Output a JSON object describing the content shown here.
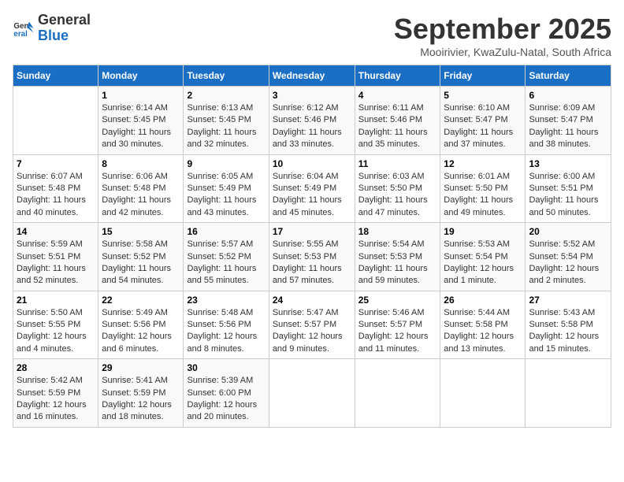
{
  "logo": {
    "line1": "General",
    "line2": "Blue"
  },
  "title": "September 2025",
  "subtitle": "Mooirivier, KwaZulu-Natal, South Africa",
  "days_of_week": [
    "Sunday",
    "Monday",
    "Tuesday",
    "Wednesday",
    "Thursday",
    "Friday",
    "Saturday"
  ],
  "weeks": [
    [
      {
        "day": "",
        "info": ""
      },
      {
        "day": "1",
        "info": "Sunrise: 6:14 AM\nSunset: 5:45 PM\nDaylight: 11 hours\nand 30 minutes."
      },
      {
        "day": "2",
        "info": "Sunrise: 6:13 AM\nSunset: 5:45 PM\nDaylight: 11 hours\nand 32 minutes."
      },
      {
        "day": "3",
        "info": "Sunrise: 6:12 AM\nSunset: 5:46 PM\nDaylight: 11 hours\nand 33 minutes."
      },
      {
        "day": "4",
        "info": "Sunrise: 6:11 AM\nSunset: 5:46 PM\nDaylight: 11 hours\nand 35 minutes."
      },
      {
        "day": "5",
        "info": "Sunrise: 6:10 AM\nSunset: 5:47 PM\nDaylight: 11 hours\nand 37 minutes."
      },
      {
        "day": "6",
        "info": "Sunrise: 6:09 AM\nSunset: 5:47 PM\nDaylight: 11 hours\nand 38 minutes."
      }
    ],
    [
      {
        "day": "7",
        "info": "Sunrise: 6:07 AM\nSunset: 5:48 PM\nDaylight: 11 hours\nand 40 minutes."
      },
      {
        "day": "8",
        "info": "Sunrise: 6:06 AM\nSunset: 5:48 PM\nDaylight: 11 hours\nand 42 minutes."
      },
      {
        "day": "9",
        "info": "Sunrise: 6:05 AM\nSunset: 5:49 PM\nDaylight: 11 hours\nand 43 minutes."
      },
      {
        "day": "10",
        "info": "Sunrise: 6:04 AM\nSunset: 5:49 PM\nDaylight: 11 hours\nand 45 minutes."
      },
      {
        "day": "11",
        "info": "Sunrise: 6:03 AM\nSunset: 5:50 PM\nDaylight: 11 hours\nand 47 minutes."
      },
      {
        "day": "12",
        "info": "Sunrise: 6:01 AM\nSunset: 5:50 PM\nDaylight: 11 hours\nand 49 minutes."
      },
      {
        "day": "13",
        "info": "Sunrise: 6:00 AM\nSunset: 5:51 PM\nDaylight: 11 hours\nand 50 minutes."
      }
    ],
    [
      {
        "day": "14",
        "info": "Sunrise: 5:59 AM\nSunset: 5:51 PM\nDaylight: 11 hours\nand 52 minutes."
      },
      {
        "day": "15",
        "info": "Sunrise: 5:58 AM\nSunset: 5:52 PM\nDaylight: 11 hours\nand 54 minutes."
      },
      {
        "day": "16",
        "info": "Sunrise: 5:57 AM\nSunset: 5:52 PM\nDaylight: 11 hours\nand 55 minutes."
      },
      {
        "day": "17",
        "info": "Sunrise: 5:55 AM\nSunset: 5:53 PM\nDaylight: 11 hours\nand 57 minutes."
      },
      {
        "day": "18",
        "info": "Sunrise: 5:54 AM\nSunset: 5:53 PM\nDaylight: 11 hours\nand 59 minutes."
      },
      {
        "day": "19",
        "info": "Sunrise: 5:53 AM\nSunset: 5:54 PM\nDaylight: 12 hours\nand 1 minute."
      },
      {
        "day": "20",
        "info": "Sunrise: 5:52 AM\nSunset: 5:54 PM\nDaylight: 12 hours\nand 2 minutes."
      }
    ],
    [
      {
        "day": "21",
        "info": "Sunrise: 5:50 AM\nSunset: 5:55 PM\nDaylight: 12 hours\nand 4 minutes."
      },
      {
        "day": "22",
        "info": "Sunrise: 5:49 AM\nSunset: 5:56 PM\nDaylight: 12 hours\nand 6 minutes."
      },
      {
        "day": "23",
        "info": "Sunrise: 5:48 AM\nSunset: 5:56 PM\nDaylight: 12 hours\nand 8 minutes."
      },
      {
        "day": "24",
        "info": "Sunrise: 5:47 AM\nSunset: 5:57 PM\nDaylight: 12 hours\nand 9 minutes."
      },
      {
        "day": "25",
        "info": "Sunrise: 5:46 AM\nSunset: 5:57 PM\nDaylight: 12 hours\nand 11 minutes."
      },
      {
        "day": "26",
        "info": "Sunrise: 5:44 AM\nSunset: 5:58 PM\nDaylight: 12 hours\nand 13 minutes."
      },
      {
        "day": "27",
        "info": "Sunrise: 5:43 AM\nSunset: 5:58 PM\nDaylight: 12 hours\nand 15 minutes."
      }
    ],
    [
      {
        "day": "28",
        "info": "Sunrise: 5:42 AM\nSunset: 5:59 PM\nDaylight: 12 hours\nand 16 minutes."
      },
      {
        "day": "29",
        "info": "Sunrise: 5:41 AM\nSunset: 5:59 PM\nDaylight: 12 hours\nand 18 minutes."
      },
      {
        "day": "30",
        "info": "Sunrise: 5:39 AM\nSunset: 6:00 PM\nDaylight: 12 hours\nand 20 minutes."
      },
      {
        "day": "",
        "info": ""
      },
      {
        "day": "",
        "info": ""
      },
      {
        "day": "",
        "info": ""
      },
      {
        "day": "",
        "info": ""
      }
    ]
  ]
}
